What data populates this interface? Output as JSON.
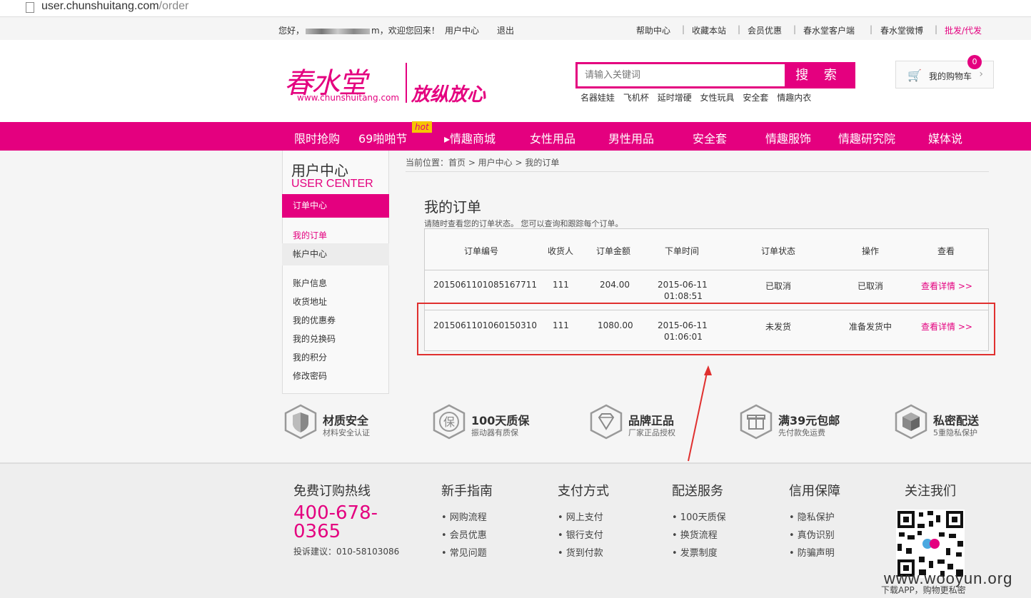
{
  "browser": {
    "url_host": "user.chunshuitang.com",
    "url_path": "/order"
  },
  "topbar": {
    "greeting_prefix": "您好，",
    "greeting_suffix": "m，欢迎您回来！",
    "user_center": "用户中心",
    "logout": "退出",
    "links": [
      "帮助中心",
      "收藏本站",
      "会员优惠",
      "春水堂客户端",
      "春水堂微博"
    ],
    "wholesale": "批发/代发",
    "separator": "|"
  },
  "header": {
    "logo_text": "春水堂",
    "logo_url": "www.chunshuitang.com",
    "slogan": "放纵放心",
    "search_placeholder": "请输入关键词",
    "search_button": "搜 索",
    "hot_words": [
      "名器娃娃",
      "飞机杯",
      "延时增硬",
      "女性玩具",
      "安全套",
      "情趣内衣"
    ],
    "cart_label": "我的购物车",
    "cart_count": "0",
    "cart_arrow": "›"
  },
  "nav": {
    "items": [
      "限时抢购",
      "69啪啪节",
      "▸情趣商城",
      "女性用品",
      "男性用品",
      "安全套",
      "情趣服饰",
      "情趣研究院",
      "媒体说"
    ],
    "hot_badge": "hot"
  },
  "sidebar": {
    "title": "用户中心",
    "subtitle": "USER CENTER",
    "order_center": "订单中心",
    "my_orders": "我的订单",
    "account_center": "帐户中心",
    "account_links": [
      "账户信息",
      "收货地址",
      "我的优惠券",
      "我的兑换码",
      "我的积分",
      "修改密码"
    ]
  },
  "main": {
    "breadcrumb": "当前位置：首页 > 用户中心 > 我的订单",
    "title": "我的订单",
    "description": "请随时查看您的订单状态。 您可以查询和跟踪每个订单。",
    "columns": [
      "订单编号",
      "收货人",
      "订单金额",
      "下单时间",
      "订单状态",
      "操作",
      "查看"
    ],
    "orders": [
      {
        "id": "2015061101085167711",
        "receiver": "111",
        "amount": "204.00",
        "date": "2015-06-11",
        "time": "01:08:51",
        "status": "已取消",
        "action": "已取消",
        "view": "查看详情 >>"
      },
      {
        "id": "2015061101060150310",
        "receiver": "111",
        "amount": "1080.00",
        "date": "2015-06-11",
        "time": "01:06:01",
        "status": "未发货",
        "action": "准备发货中",
        "view": "查看详情 >>"
      }
    ]
  },
  "features": [
    {
      "icon": "shield-icon",
      "title": "材质安全",
      "desc": "材料安全认证"
    },
    {
      "icon": "guarantee-icon",
      "title": "100天质保",
      "desc": "振动器有质保",
      "glyph": "保"
    },
    {
      "icon": "diamond-icon",
      "title": "品牌正品",
      "desc": "厂家正品授权"
    },
    {
      "icon": "gift-icon",
      "title": "满39元包邮",
      "desc": "先付款免运费"
    },
    {
      "icon": "box-icon",
      "title": "私密配送",
      "desc": "5重隐私保护"
    }
  ],
  "footer": {
    "hotline_title": "免费订购热线",
    "hotline_number_1": "400-678-",
    "hotline_number_2": "0365",
    "complaint": "投诉建议：010-58103086",
    "columns": [
      {
        "title": "新手指南",
        "links": [
          "• 网购流程",
          "• 会员优惠",
          "• 常见问题"
        ]
      },
      {
        "title": "支付方式",
        "links": [
          "• 网上支付",
          "• 银行支付",
          "• 货到付款"
        ]
      },
      {
        "title": "配送服务",
        "links": [
          "• 100天质保",
          "• 换货流程",
          "• 发票制度"
        ]
      },
      {
        "title": "信用保障",
        "links": [
          "• 隐私保护",
          "• 真伪识别",
          "• 防骗声明"
        ]
      }
    ],
    "follow_title": "关注我们",
    "qr_caption": "下载APP，购物更私密",
    "watermark": "www.wooyun.org"
  },
  "colors": {
    "brand": "#e4007f",
    "highlight_box": "#e0302f"
  }
}
